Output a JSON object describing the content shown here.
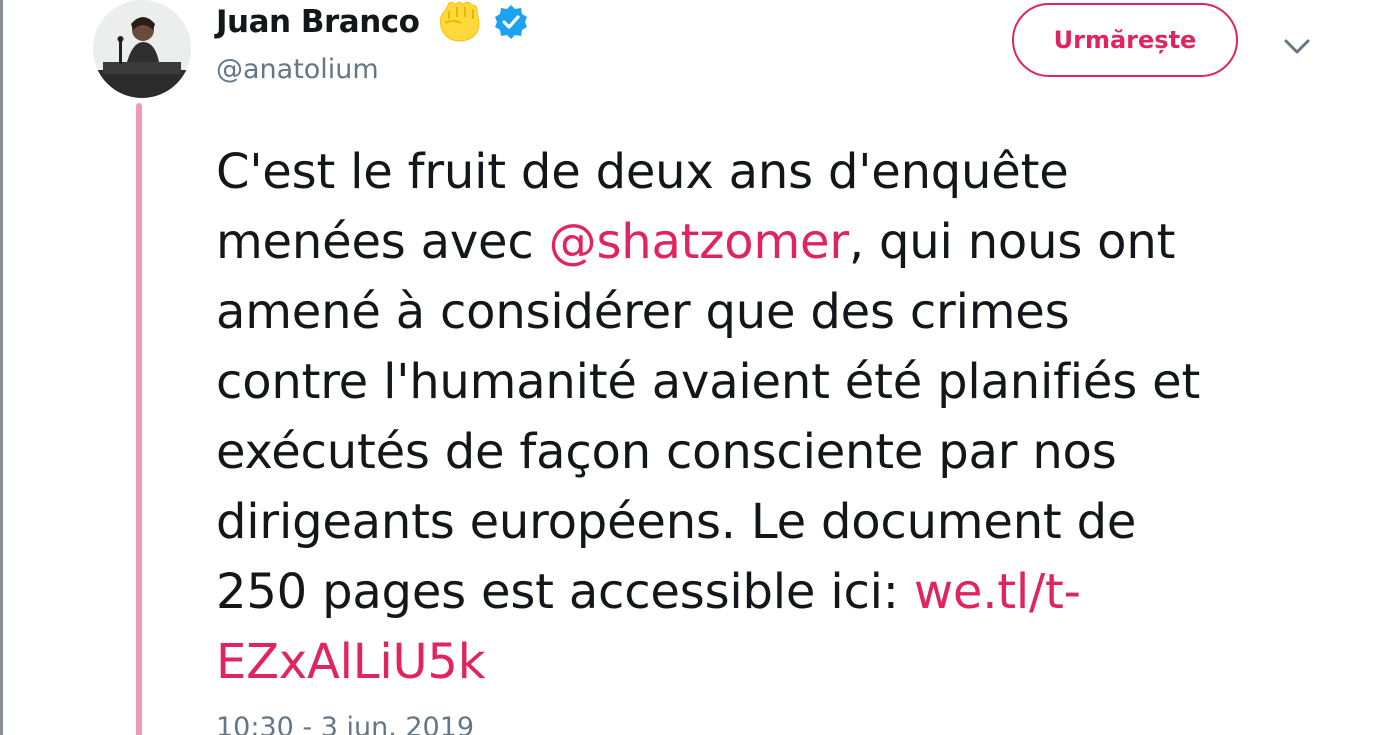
{
  "user": {
    "display_name": "Juan Branco",
    "handle": "@anatolium",
    "verified": true,
    "emoji_icon": "raised-fist-icon"
  },
  "actions": {
    "follow_label": "Urmărește",
    "menu_icon": "chevron-down-icon"
  },
  "tweet": {
    "lines": [
      {
        "before": "C'est le fruit de deux ans d'enquête",
        "mention": "",
        "after": ""
      },
      {
        "before": "menées avec ",
        "mention": "@shatzomer",
        "after": ", qui nous ont"
      },
      {
        "before": "amené à considérer que des crimes",
        "mention": "",
        "after": ""
      },
      {
        "before": "contre l'humanité avaient été planifiés et",
        "mention": "",
        "after": ""
      },
      {
        "before": "exécutés de façon consciente par nos",
        "mention": "",
        "after": ""
      },
      {
        "before": "dirigeants européens. Le document de",
        "mention": "",
        "after": ""
      },
      {
        "before": "250 pages est accessible ici: ",
        "mention": "",
        "after": ""
      }
    ],
    "link_part1": "we.tl/t-",
    "link_part2": "EZxAlLiU5k"
  },
  "timestamp": "10:30 - 3 iun. 2019",
  "colors": {
    "accent": "#e0245e",
    "thread_line": "#f29ab4",
    "secondary_text": "#657786",
    "verified": "#1da1f2"
  }
}
